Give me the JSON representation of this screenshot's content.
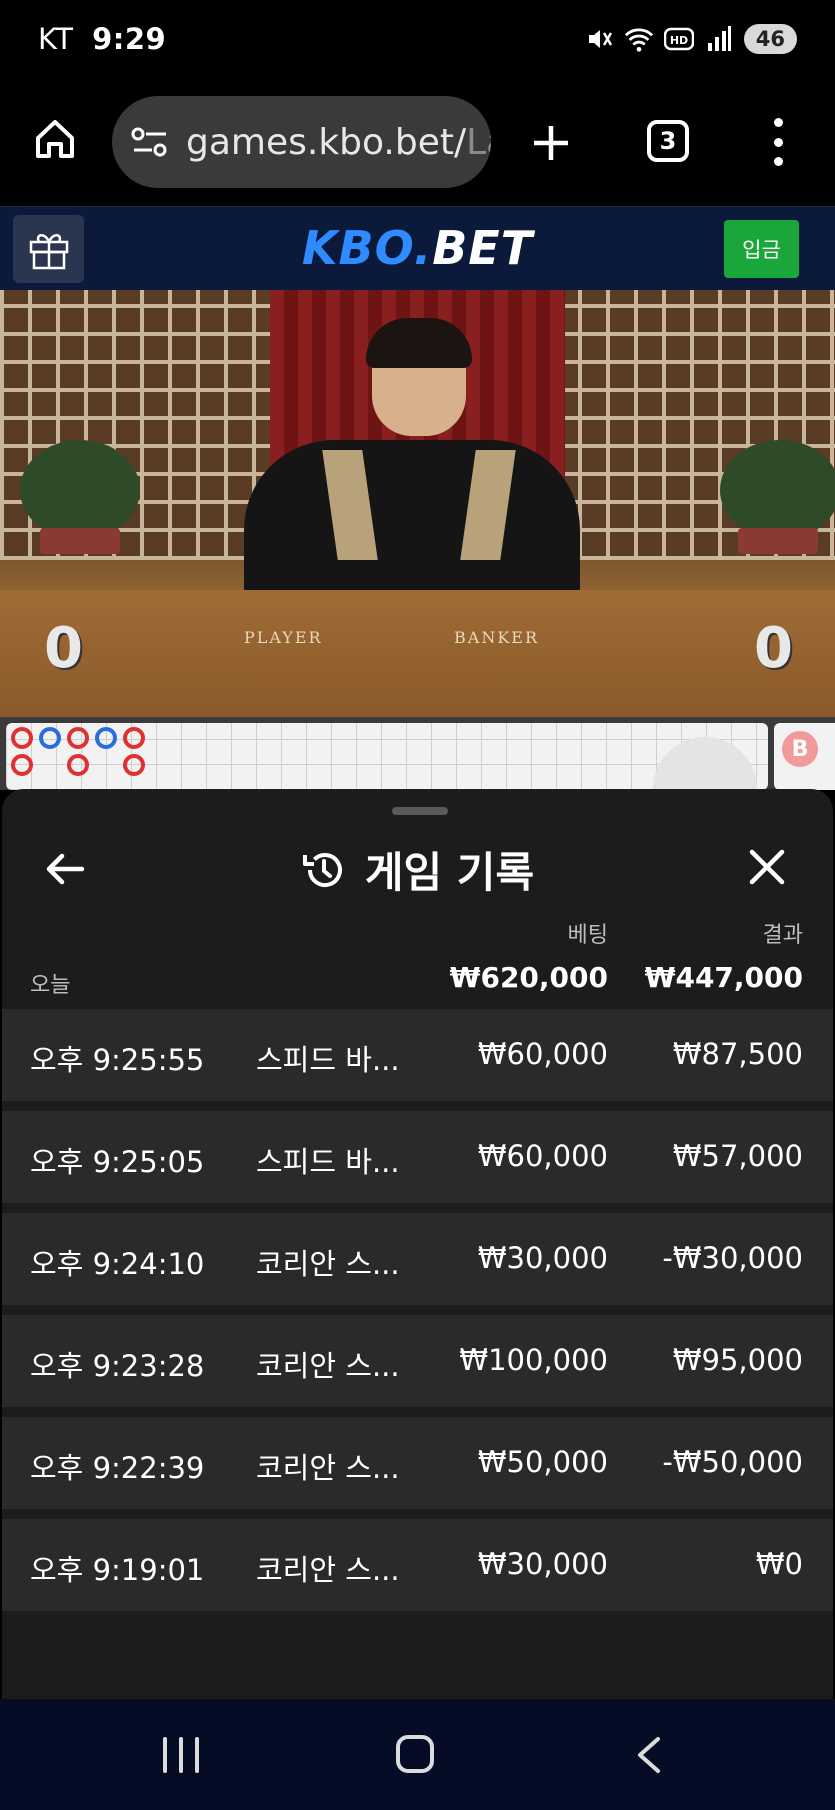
{
  "status_bar": {
    "carrier": "KT",
    "time": "9:29",
    "battery": "46",
    "icons": [
      "mute-icon",
      "wifi-icon",
      "hd-icon",
      "signal-icon"
    ]
  },
  "browser": {
    "url_main": "games.kbo.bet/",
    "url_faded": "La",
    "tab_count": "3"
  },
  "site_header": {
    "logo_kbo": "KBO",
    "logo_dot": ".",
    "logo_bet": "BET",
    "deposit_label": "입금"
  },
  "video": {
    "player_label": "PLAYER",
    "banker_label": "BANKER",
    "player_score": "0",
    "banker_score": "0"
  },
  "roadmap": {
    "badge": "B"
  },
  "sheet": {
    "title": "게임 기록",
    "col_bet": "베팅",
    "col_result": "결과",
    "today_label": "오늘",
    "total_bet": "₩620,000",
    "total_result": "₩447,000",
    "rows": [
      {
        "time": "오후 9:25:55",
        "game": "스피드 바...",
        "bet": "₩60,000",
        "result": "₩87,500"
      },
      {
        "time": "오후 9:25:05",
        "game": "스피드 바...",
        "bet": "₩60,000",
        "result": "₩57,000"
      },
      {
        "time": "오후 9:24:10",
        "game": "코리안 스...",
        "bet": "₩30,000",
        "result": "-₩30,000"
      },
      {
        "time": "오후 9:23:28",
        "game": "코리안 스...",
        "bet": "₩100,000",
        "result": "₩95,000"
      },
      {
        "time": "오후 9:22:39",
        "game": "코리안 스...",
        "bet": "₩50,000",
        "result": "-₩50,000"
      },
      {
        "time": "오후 9:19:01",
        "game": "코리안 스...",
        "bet": "₩30,000",
        "result": "₩0"
      }
    ]
  },
  "colors": {
    "site_header_bg": "#0b1a3b",
    "logo_blue": "#2f8bff",
    "deposit_green": "#1aa63a",
    "sheet_bg": "#1c1c1c",
    "row_bg": "#2a2a2a",
    "nav_bg": "#050d26"
  }
}
